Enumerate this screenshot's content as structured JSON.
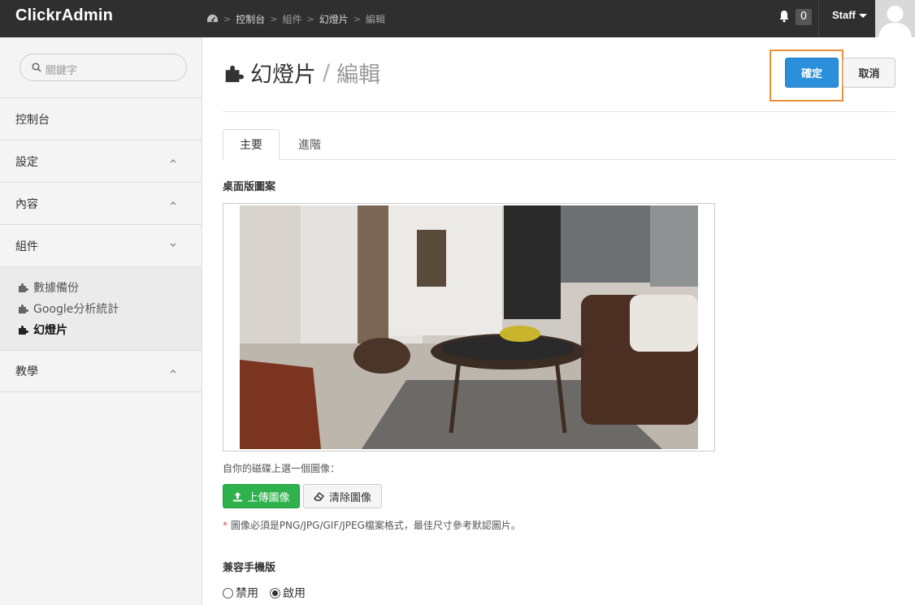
{
  "app": {
    "brand": "ClickrAdmin"
  },
  "breadcrumb": {
    "items": [
      "控制台",
      "組件",
      "幻燈片",
      "編輯"
    ]
  },
  "header": {
    "notification_count": "0",
    "user_label": "Staff"
  },
  "sidebar": {
    "search_placeholder": "關鍵字",
    "items": [
      {
        "label": "控制台"
      },
      {
        "label": "設定"
      },
      {
        "label": "內容"
      },
      {
        "label": "組件"
      }
    ],
    "sub_items": [
      {
        "label": "數據備份"
      },
      {
        "label": "Google分析統計"
      },
      {
        "label": "幻燈片"
      }
    ],
    "last_item": {
      "label": "教學"
    }
  },
  "main": {
    "title": "幻燈片",
    "slash": "/",
    "subtitle": "編輯",
    "confirm_label": "確定",
    "cancel_label": "取消",
    "tabs": [
      {
        "label": "主要"
      },
      {
        "label": "進階"
      }
    ],
    "desktop_image_label": "桌面版圖案",
    "select_hint": "自你的磁碟上選一個圖像：",
    "upload_label": "上傳圖像",
    "clear_label": "清除圖像",
    "required_mark": "*",
    "format_note": " 圖像必須是PNG/JPG/GIF/JPEG檔案格式，最佳尺寸參考默認圖片。",
    "mobile_label": "兼容手機版",
    "radio_options": [
      {
        "label": "禁用"
      },
      {
        "label": "啟用"
      }
    ],
    "radio_selected": "啟用"
  },
  "colors": {
    "topbar": "#2f2f2f",
    "primary": "#2b8fdb",
    "success": "#2fb14c",
    "highlight": "#e8913a"
  }
}
